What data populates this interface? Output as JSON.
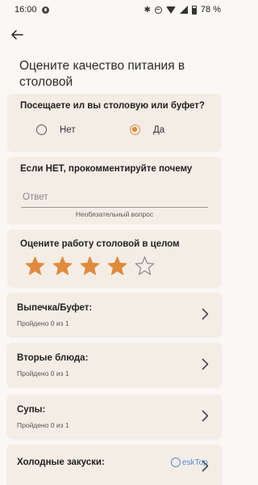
{
  "status_bar": {
    "time": "16:00",
    "battery": "78 %",
    "icons": [
      "app-notification-icon",
      "bluetooth-icon",
      "do-not-disturb-icon",
      "wifi-icon",
      "signal-icon",
      "battery-icon"
    ]
  },
  "header": {
    "back_icon": "arrow-left-icon",
    "title": "Оцените качество питания в столовой"
  },
  "question_visit": {
    "label": "Посещаете ил вы столовую или буфет?",
    "options": [
      {
        "label": "Нет",
        "selected": false
      },
      {
        "label": "Да",
        "selected": true
      }
    ]
  },
  "question_comment": {
    "label": "Если НЕТ, прокомментируйте почему",
    "placeholder": "Ответ",
    "value": "",
    "hint": "Необязательный вопрос"
  },
  "question_rating": {
    "label": "Оцените работу столовой в целом",
    "rating": 4,
    "max": 5
  },
  "categories": [
    {
      "title": "Выпечка/Буфет:",
      "progress": "Пройдено 0 из 1"
    },
    {
      "title": "Вторые блюда:",
      "progress": "Пройдено 0 из 1"
    },
    {
      "title": "Супы:",
      "progress": "Пройдено 0 из 1"
    },
    {
      "title": "Холодные закуски:",
      "progress": ""
    }
  ],
  "watermark": {
    "text": "eskTop"
  },
  "colors": {
    "accent": "#e08a3c",
    "card_bg": "#f4ede6",
    "page_bg": "#faf7f4"
  }
}
